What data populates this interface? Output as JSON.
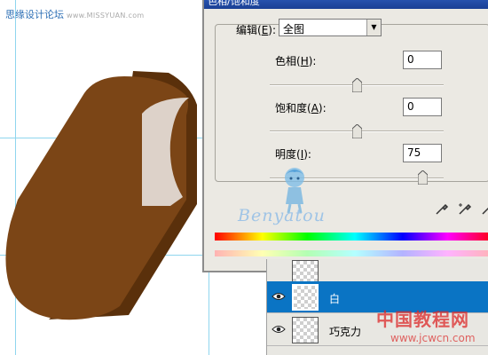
{
  "watermark_top": {
    "text": "思缘设计论坛",
    "site": "www.MISSYUAN.com"
  },
  "dialog": {
    "title": "色相/饱和度",
    "edit_label": "编辑",
    "edit_key": "E",
    "edit_value": "全图",
    "hue": {
      "label": "色相",
      "key": "H",
      "value": "0",
      "level": 0.5
    },
    "saturation": {
      "label": "饱和度",
      "key": "A",
      "value": "0",
      "level": 0.5
    },
    "lightness": {
      "label": "明度",
      "key": "I",
      "value": "75",
      "level": 0.875
    },
    "logo_text": "Benyatou"
  },
  "layers": [
    {
      "name": "",
      "visible": false,
      "selected": false
    },
    {
      "name": "白",
      "visible": true,
      "selected": true
    },
    {
      "name": "巧克力",
      "visible": true,
      "selected": false
    }
  ],
  "watermark_bottom": {
    "text": "中国教程网",
    "url": "www.jcwcn.com"
  },
  "colors": {
    "chocolate": "#7b4516",
    "chocolate_dark": "#5a300b",
    "bite": "#ddd2c9",
    "selection": "#0a74c4"
  }
}
